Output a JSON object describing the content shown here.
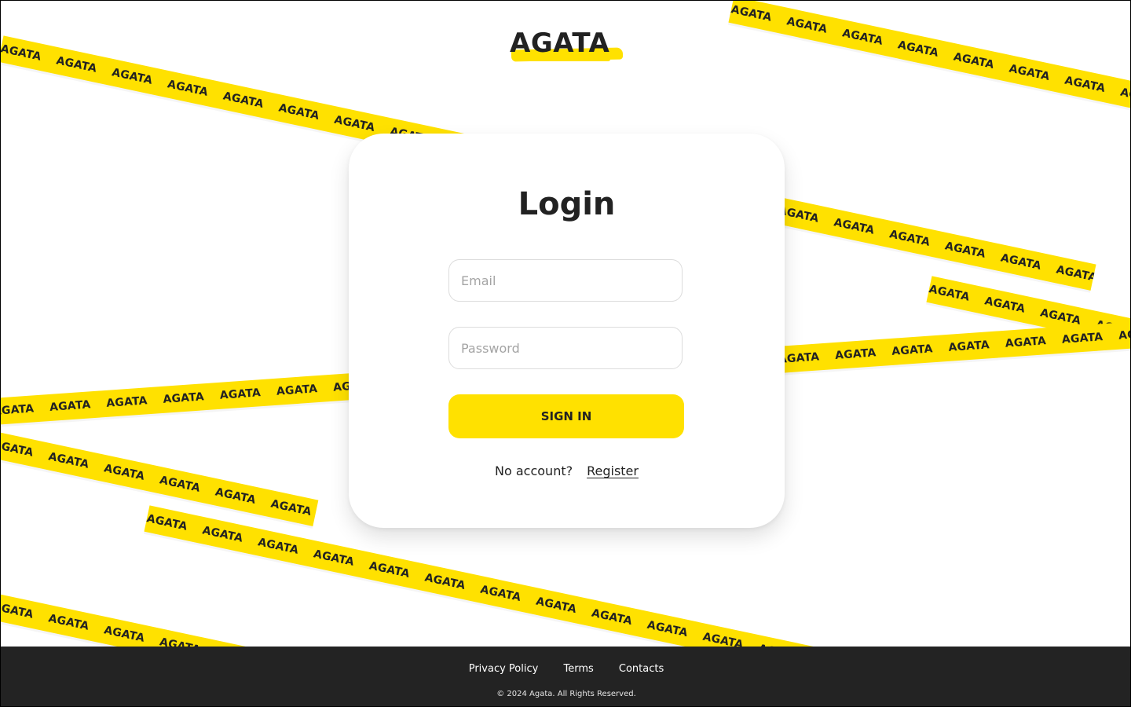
{
  "brand": {
    "logo_text": "AGATA",
    "tape_word": "AGATA",
    "accent_color": "#ffe100",
    "dark_color": "#222222"
  },
  "login": {
    "title": "Login",
    "email_placeholder": "Email",
    "email_value": "",
    "password_placeholder": "Password",
    "password_value": "",
    "signin_label": "SIGN IN",
    "no_account_text": "No account?",
    "register_label": "Register"
  },
  "footer": {
    "links": [
      "Privacy Policy",
      "Terms",
      "Contacts"
    ],
    "copyright": "© 2024  Agata.  All Rights Reserved."
  }
}
